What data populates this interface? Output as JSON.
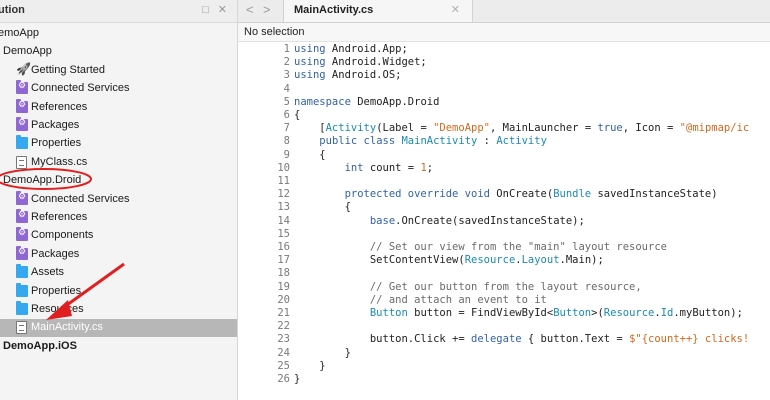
{
  "solution_pad": {
    "title": "ution",
    "controls": "□ ✕",
    "items": [
      {
        "label": "emoApp",
        "icon": "solution-icon",
        "indent": -2,
        "bold": false,
        "selected": false
      },
      {
        "label": "DemoApp",
        "icon": "project-icon",
        "indent": 3,
        "bold": false,
        "selected": false
      },
      {
        "label": "Getting Started",
        "icon": "rocket-icon",
        "indent": 16,
        "bold": false,
        "selected": false
      },
      {
        "label": "Connected Services",
        "icon": "folder-gear-icon",
        "indent": 16,
        "bold": false,
        "selected": false
      },
      {
        "label": "References",
        "icon": "folder-gear-icon",
        "indent": 16,
        "bold": false,
        "selected": false
      },
      {
        "label": "Packages",
        "icon": "folder-gear-icon",
        "indent": 16,
        "bold": false,
        "selected": false
      },
      {
        "label": "Properties",
        "icon": "folder-icon",
        "indent": 16,
        "bold": false,
        "selected": false
      },
      {
        "label": "MyClass.cs",
        "icon": "file-icon",
        "indent": 16,
        "bold": false,
        "selected": false
      },
      {
        "label": "DemoApp.Droid",
        "icon": "project-icon",
        "indent": 3,
        "bold": false,
        "selected": false
      },
      {
        "label": "Connected Services",
        "icon": "folder-gear-icon",
        "indent": 16,
        "bold": false,
        "selected": false
      },
      {
        "label": "References",
        "icon": "folder-gear-icon",
        "indent": 16,
        "bold": false,
        "selected": false
      },
      {
        "label": "Components",
        "icon": "folder-gear-icon",
        "indent": 16,
        "bold": false,
        "selected": false
      },
      {
        "label": "Packages",
        "icon": "folder-gear-icon",
        "indent": 16,
        "bold": false,
        "selected": false
      },
      {
        "label": "Assets",
        "icon": "folder-icon",
        "indent": 16,
        "bold": false,
        "selected": false
      },
      {
        "label": "Properties",
        "icon": "folder-icon",
        "indent": 16,
        "bold": false,
        "selected": false
      },
      {
        "label": "Resources",
        "icon": "folder-icon",
        "indent": 16,
        "bold": false,
        "selected": false
      },
      {
        "label": "MainActivity.cs",
        "icon": "file-icon",
        "indent": 16,
        "bold": false,
        "selected": true
      },
      {
        "label": "DemoApp.iOS",
        "icon": "project-icon",
        "indent": 3,
        "bold": true,
        "selected": false
      }
    ]
  },
  "editor": {
    "nav_back": "<",
    "nav_forward": ">",
    "tab_label": "MainActivity.cs",
    "tab_close": "✕",
    "breadcrumb": "No selection",
    "lines": [
      {
        "n": "1",
        "html": "<span class=\"kw\">using</span> Android.App;"
      },
      {
        "n": "2",
        "html": "<span class=\"kw\">using</span> Android.Widget;"
      },
      {
        "n": "3",
        "html": "<span class=\"kw\">using</span> Android.OS;"
      },
      {
        "n": "4",
        "html": ""
      },
      {
        "n": "5",
        "html": "<span class=\"kw\">namespace</span> DemoApp.Droid"
      },
      {
        "n": "6",
        "html": "{"
      },
      {
        "n": "7",
        "html": "    [<span class=\"ty\">Activity</span>(Label = <span class=\"st\">\"DemoApp\"</span>, MainLauncher = <span class=\"kw\">true</span>, Icon = <span class=\"st\">\"@mipmap/ic</span>"
      },
      {
        "n": "8",
        "html": "    <span class=\"kw\">public class</span> <span class=\"ty\">MainActivity</span> : <span class=\"ty\">Activity</span>"
      },
      {
        "n": "9",
        "html": "    {"
      },
      {
        "n": "10",
        "html": "        <span class=\"kw\">int</span> count = <span class=\"st\">1</span>;"
      },
      {
        "n": "11",
        "html": ""
      },
      {
        "n": "12",
        "html": "        <span class=\"kw\">protected override void</span> OnCreate(<span class=\"ty\">Bundle</span> savedInstanceState)"
      },
      {
        "n": "13",
        "html": "        {"
      },
      {
        "n": "14",
        "html": "            <span class=\"kw\">base</span>.OnCreate(savedInstanceState);"
      },
      {
        "n": "15",
        "html": ""
      },
      {
        "n": "16",
        "html": "            <span class=\"cm\">// Set our view from the \"main\" layout resource</span>"
      },
      {
        "n": "17",
        "html": "            SetContentView(<span class=\"ty\">Resource</span>.<span class=\"ty\">Layout</span>.Main);"
      },
      {
        "n": "18",
        "html": ""
      },
      {
        "n": "19",
        "html": "            <span class=\"cm\">// Get our button from the layout resource,</span>"
      },
      {
        "n": "20",
        "html": "            <span class=\"cm\">// and attach an event to it</span>"
      },
      {
        "n": "21",
        "html": "            <span class=\"ty\">Button</span> button = FindViewById&lt;<span class=\"ty\">Button</span>&gt;(<span class=\"ty\">Resource</span>.<span class=\"ty\">Id</span>.myButton);"
      },
      {
        "n": "22",
        "html": ""
      },
      {
        "n": "23",
        "html": "            button.Click += <span class=\"kw\">delegate</span> { button.Text = <span class=\"st\">$\"{count++} clicks!</span>"
      },
      {
        "n": "24",
        "html": "        }"
      },
      {
        "n": "25",
        "html": "    }"
      },
      {
        "n": "26",
        "html": "}"
      }
    ]
  },
  "colors": {
    "folder": "#35a8ef",
    "gear_folder": "#8f67d4",
    "selected_row": "#b7b7b7",
    "keyword": "#3362a8",
    "type": "#1a8ab4",
    "string": "#d2691e",
    "annotation": "#e02020"
  }
}
